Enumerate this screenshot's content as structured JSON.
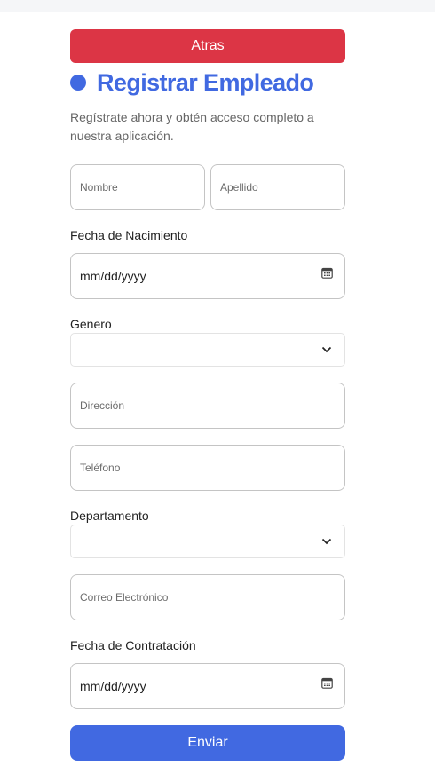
{
  "buttons": {
    "back": "Atras",
    "submit": "Enviar"
  },
  "header": {
    "title": "Registrar Empleado",
    "subtitle": "Regístrate ahora y obtén acceso completo a nuestra aplicación."
  },
  "fields": {
    "first_name": {
      "placeholder": "Nombre"
    },
    "last_name": {
      "placeholder": "Apellido"
    },
    "birth_date": {
      "label": "Fecha de Nacimiento",
      "value": "mm/dd/yyyy"
    },
    "gender": {
      "label": "Genero",
      "value": ""
    },
    "address": {
      "placeholder": "Dirección"
    },
    "phone": {
      "placeholder": "Teléfono"
    },
    "department": {
      "label": "Departamento",
      "value": ""
    },
    "email": {
      "placeholder": "Correo Electrónico"
    },
    "hire_date": {
      "label": "Fecha de Contratación",
      "value": "mm/dd/yyyy"
    }
  },
  "colors": {
    "accent": "#4169e1",
    "danger": "#dc3545",
    "border": "#c4c4c4"
  },
  "icons": [
    "calendar-icon",
    "chevron-down-icon"
  ]
}
